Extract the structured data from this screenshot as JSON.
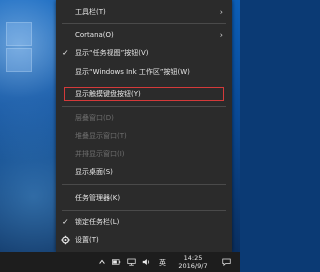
{
  "menu": {
    "items": [
      {
        "label": "工具栏(T)",
        "disabled": false,
        "checked": false,
        "submenu": true
      },
      {
        "label": "Cortana(O)",
        "disabled": false,
        "checked": false,
        "submenu": true
      },
      {
        "label": "显示“任务视图”按钮(V)",
        "disabled": false,
        "checked": true,
        "submenu": false
      },
      {
        "label": "显示“Windows Ink 工作区”按钮(W)",
        "disabled": false,
        "checked": false,
        "submenu": false
      },
      {
        "label": "显示触摸键盘按钮(Y)",
        "disabled": false,
        "checked": false,
        "submenu": false,
        "highlighted": true
      },
      {
        "label": "层叠窗口(D)",
        "disabled": true,
        "checked": false,
        "submenu": false
      },
      {
        "label": "堆叠显示窗口(T)",
        "disabled": true,
        "checked": false,
        "submenu": false
      },
      {
        "label": "并排显示窗口(I)",
        "disabled": true,
        "checked": false,
        "submenu": false
      },
      {
        "label": "显示桌面(S)",
        "disabled": false,
        "checked": false,
        "submenu": false
      },
      {
        "label": "任务管理器(K)",
        "disabled": false,
        "checked": false,
        "submenu": false
      },
      {
        "label": "锁定任务栏(L)",
        "disabled": false,
        "checked": true,
        "submenu": false
      },
      {
        "label": "设置(T)",
        "disabled": false,
        "checked": false,
        "submenu": false,
        "icon": "gear-icon"
      }
    ]
  },
  "taskbar": {
    "ime": "英",
    "time": "14:25",
    "date": "2016/9/7"
  },
  "colors": {
    "menu_bg": "#2b2b2b",
    "highlight_border": "#d43a3a",
    "taskbar_bg": "#1d1d1d"
  }
}
